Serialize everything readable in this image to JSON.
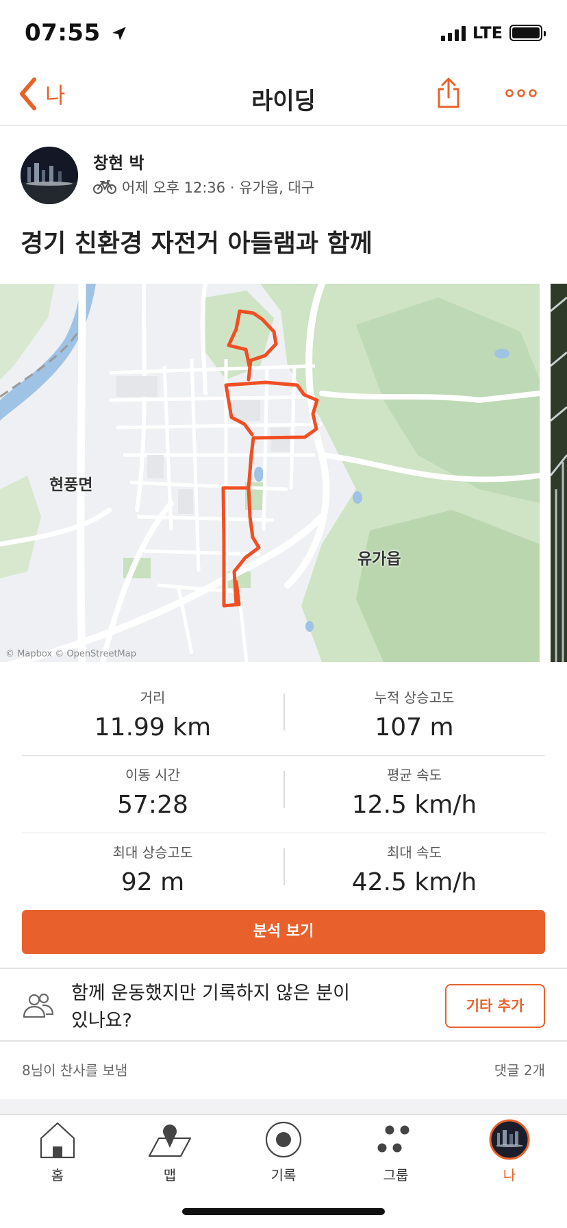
{
  "status_bar": {
    "time": "07:55",
    "network": "LTE"
  },
  "nav": {
    "back_label": "나",
    "title": "라이딩"
  },
  "athlete": {
    "name": "창현 박",
    "meta": "어제 오후 12:36 · 유가읍, 대구",
    "activity_icon": "bike-icon"
  },
  "activity": {
    "title": "경기 친환경 자전거 아들램과 함께"
  },
  "map": {
    "labels": {
      "west": "현풍면",
      "east": "유가읍"
    },
    "attribution": "© Mapbox © OpenStreetMap",
    "route_color": "#f04e23"
  },
  "stats": [
    {
      "left": {
        "label": "거리",
        "value": "11.99 km"
      },
      "right": {
        "label": "누적 상승고도",
        "value": "107 m"
      }
    },
    {
      "left": {
        "label": "이동 시간",
        "value": "57:28"
      },
      "right": {
        "label": "평균 속도",
        "value": "12.5 km/h"
      }
    },
    {
      "left": {
        "label": "최대 상승고도",
        "value": "92 m"
      },
      "right": {
        "label": "최대 속도",
        "value": "42.5 km/h"
      }
    }
  ],
  "analysis_button": "분석 보기",
  "group_prompt": {
    "text": "함께 운동했지만 기록하지 않은 분이 있나요?",
    "button": "기타 추가"
  },
  "social": {
    "kudos": "8님이 찬사를 보냄",
    "comments": "댓글 2개"
  },
  "tabs": [
    {
      "label": "홈",
      "icon": "home-icon"
    },
    {
      "label": "맵",
      "icon": "map-pin-icon"
    },
    {
      "label": "기록",
      "icon": "record-icon"
    },
    {
      "label": "그룹",
      "icon": "groups-icon"
    },
    {
      "label": "나",
      "icon": "avatar",
      "active": true
    }
  ],
  "colors": {
    "accent": "#e9612a",
    "button": "#e8602c"
  }
}
